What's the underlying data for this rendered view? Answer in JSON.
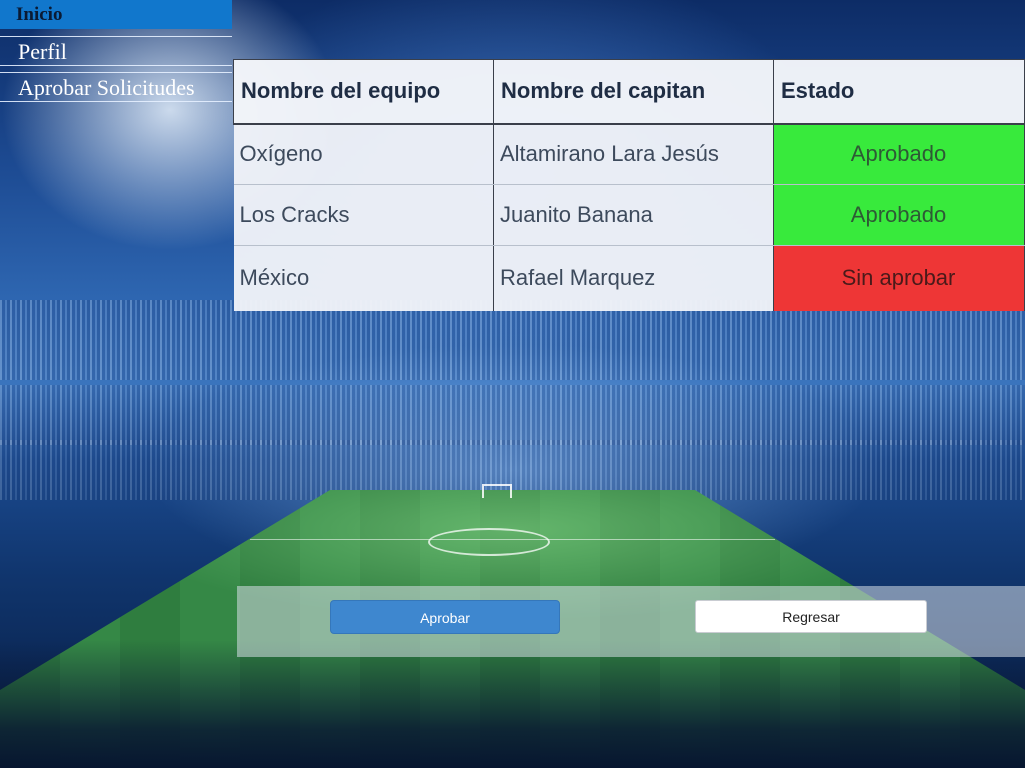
{
  "nav": {
    "items": [
      {
        "label": "Inicio"
      },
      {
        "label": "Perfil"
      },
      {
        "label": "Aprobar Solicitudes"
      }
    ]
  },
  "requests_table": {
    "columns": [
      "Nombre del equipo",
      "Nombre del capitan",
      "Estado"
    ],
    "rows": [
      {
        "team": "Oxígeno",
        "captain": "Altamirano Lara Jesús",
        "status": "Aprobado",
        "status_color": "#38ea3c"
      },
      {
        "team": "Los Cracks",
        "captain": "Juanito Banana",
        "status": "Aprobado",
        "status_color": "#38ea3c"
      },
      {
        "team": "México",
        "captain": "Rafael Marquez",
        "status": "Sin aprobar",
        "status_color": "#ee3636"
      }
    ]
  },
  "actions": {
    "approve_label": "Aprobar",
    "back_label": "Regresar"
  },
  "colors": {
    "nav_active": "#1177cc",
    "approve_button": "#3e87cf",
    "status_approved": "#38ea3c",
    "status_pending": "#ee3636"
  }
}
